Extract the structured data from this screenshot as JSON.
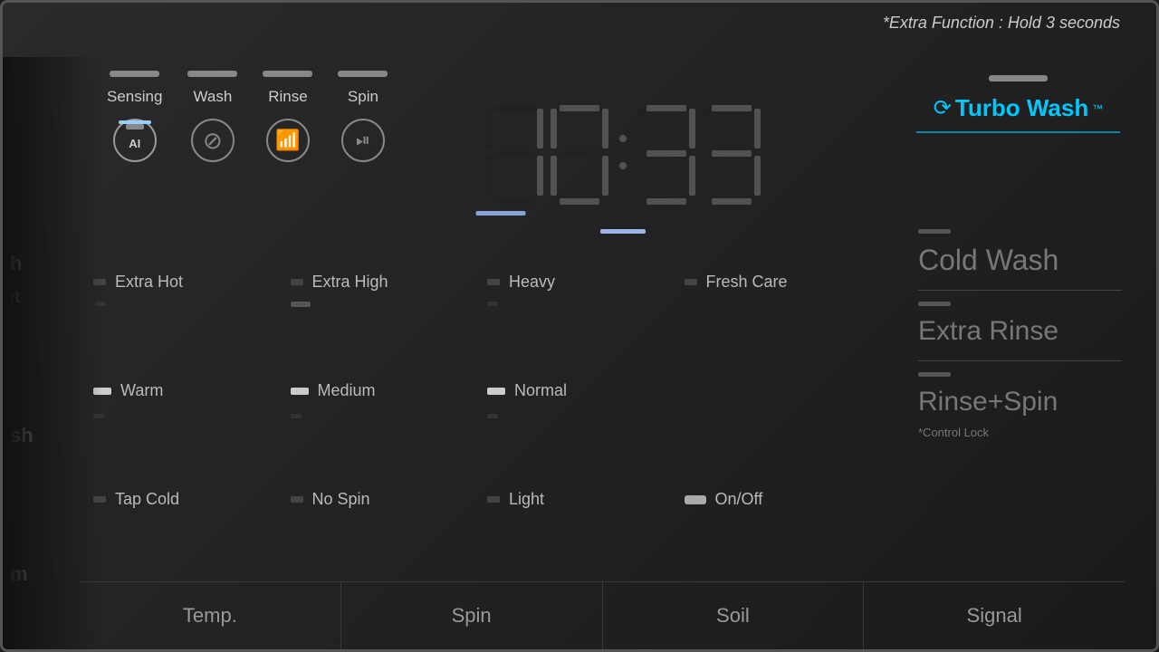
{
  "notice": {
    "text": "*Extra Function : Hold 3 seconds"
  },
  "top_indicators": [
    {
      "id": "sensing",
      "label": "Sensing",
      "active": true
    },
    {
      "id": "wash",
      "label": "Wash",
      "active": false
    },
    {
      "id": "rinse",
      "label": "Rinse",
      "active": false
    },
    {
      "id": "spin",
      "label": "Spin",
      "active": false
    }
  ],
  "display": {
    "value": "10:33"
  },
  "turbo_wash": {
    "label": "Turbo Wash",
    "tm": "™"
  },
  "temp_options": [
    {
      "label": "Extra Hot",
      "led": "small"
    },
    {
      "label": "Warm",
      "led": "active"
    },
    {
      "label": "Tap Cold",
      "led": "small"
    }
  ],
  "spin_options": [
    {
      "label": "Extra High",
      "led": "small"
    },
    {
      "label": "Medium",
      "led": "active"
    },
    {
      "label": "No Spin",
      "led": "small"
    }
  ],
  "soil_options": [
    {
      "label": "Heavy",
      "led": "small"
    },
    {
      "label": "Normal",
      "led": "active"
    },
    {
      "label": "Light",
      "led": "small"
    }
  ],
  "signal_options": [
    {
      "label": "Fresh Care",
      "led": "small"
    },
    {
      "label": "On/Off",
      "led": "active"
    }
  ],
  "right_options": [
    {
      "label": "Cold Wash",
      "has_line": true
    },
    {
      "label": "Extra Rinse",
      "has_line": true
    },
    {
      "label": "Rinse+Spin",
      "has_line": false
    }
  ],
  "bottom_labels": [
    {
      "label": "Temp."
    },
    {
      "label": "Spin"
    },
    {
      "label": "Soil"
    },
    {
      "label": "Signal"
    }
  ],
  "left_edge": {
    "text1": "h",
    "text2": "rt",
    "text3": "sh",
    "text4": "m"
  },
  "control_lock": {
    "label": "*Control Lock"
  }
}
